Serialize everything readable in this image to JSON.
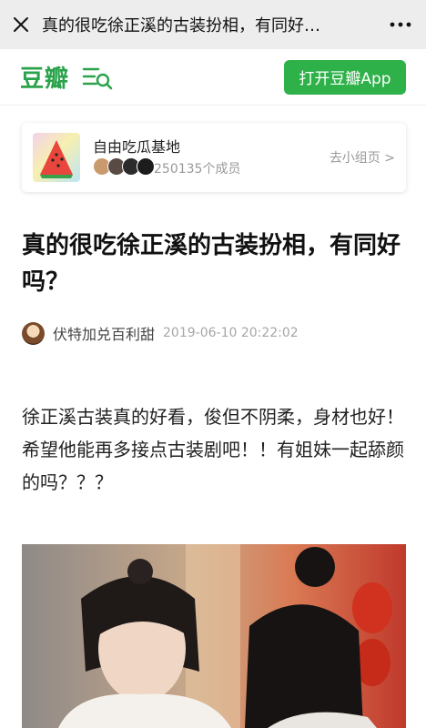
{
  "topbar": {
    "title": "真的很吃徐正溪的古装扮相，有同好…",
    "close_icon": "close-icon",
    "more_icon": "more-icon"
  },
  "header": {
    "logo": "豆瓣",
    "menu_search_icon": "menu-search-icon",
    "open_app_label": "打开豆瓣App",
    "brand_color": "#2fb14a"
  },
  "group": {
    "name": "自由吃瓜基地",
    "members": "250135个成员",
    "goto_label": "去小组页 >",
    "avatar_count": 4
  },
  "post": {
    "title": "真的很吃徐正溪的古装扮相，有同好吗？",
    "author": "伏特加兑百利甜",
    "time": "2019-06-10 20:22:02",
    "body": "徐正溪古装真的好看，俊但不阴柔，身材也好！希望他能再多接点古装剧吧！！有姐妹一起舔颜的吗？？？"
  }
}
